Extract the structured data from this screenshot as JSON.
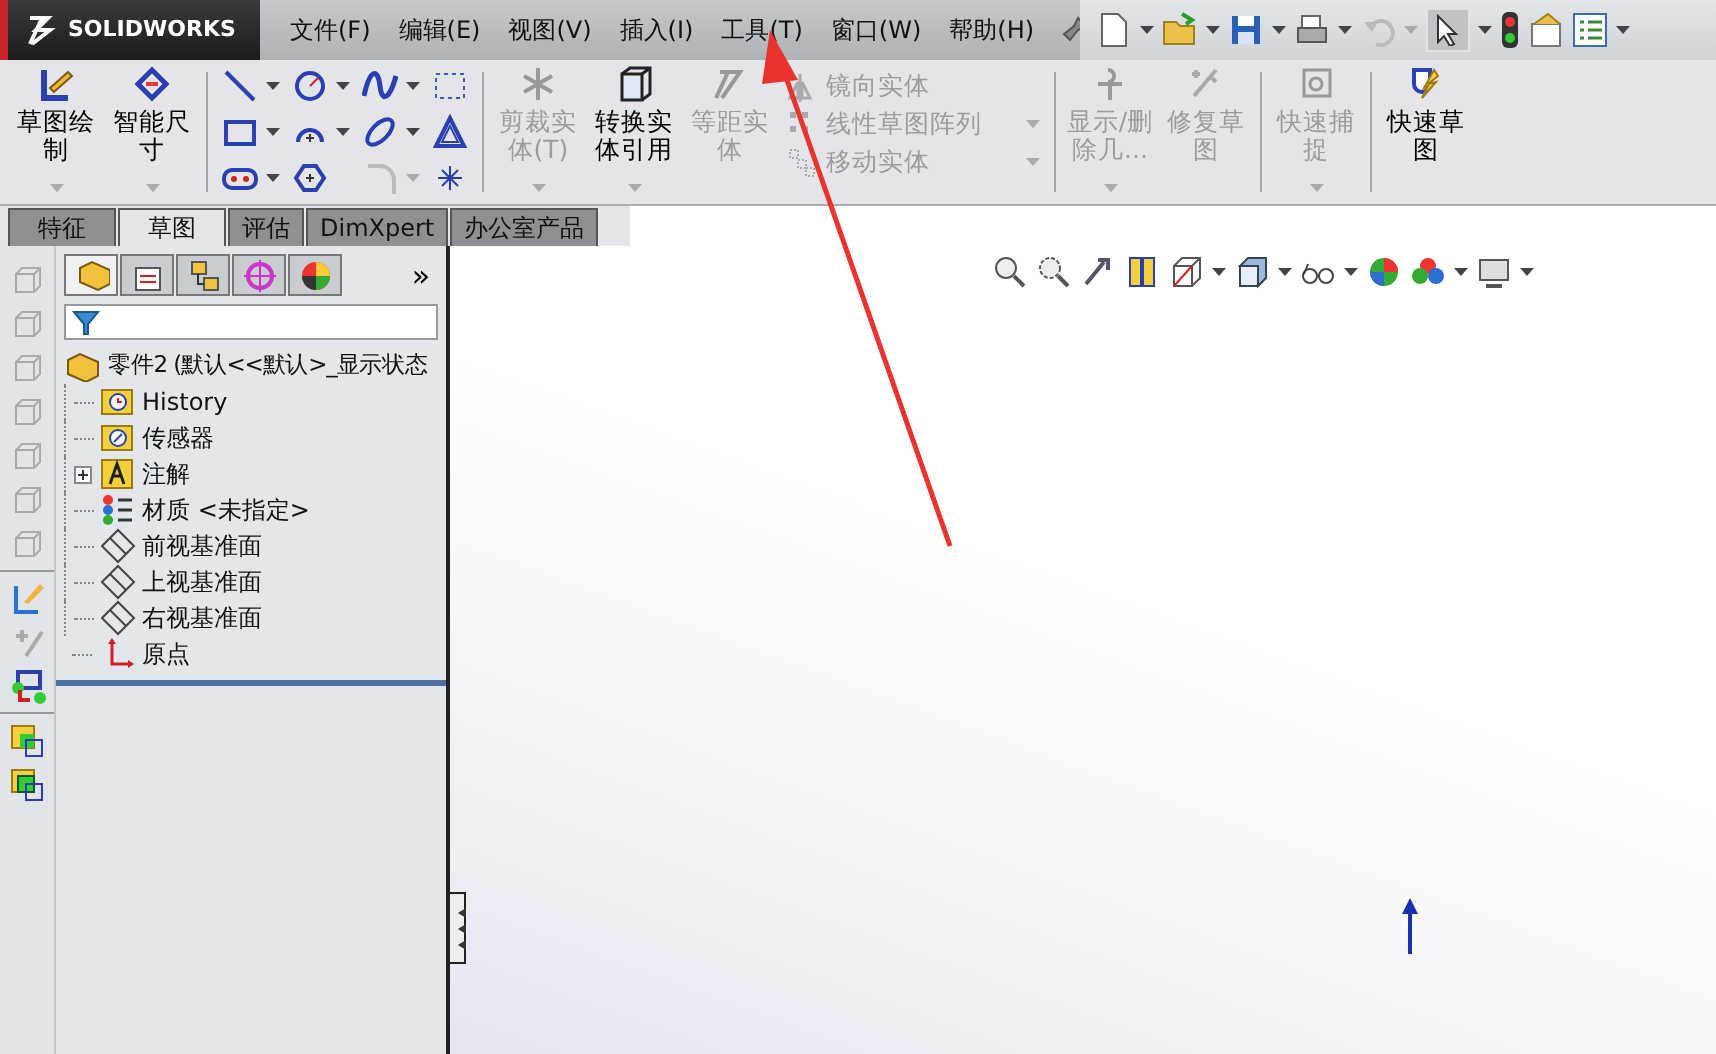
{
  "logo": {
    "text": "SOLIDWORKS"
  },
  "menu": [
    {
      "label": "文件(F)"
    },
    {
      "label": "编辑(E)"
    },
    {
      "label": "视图(V)"
    },
    {
      "label": "插入(I)"
    },
    {
      "label": "工具(T)"
    },
    {
      "label": "窗口(W)"
    },
    {
      "label": "帮助(H)"
    }
  ],
  "ribbon": {
    "items": [
      {
        "kind": "large",
        "label": "草图绘制",
        "disabled": false,
        "dropdown": true
      },
      {
        "kind": "large",
        "label": "智能尺寸",
        "disabled": false,
        "dropdown": true
      },
      {
        "kind": "separator"
      },
      {
        "kind": "tool_grid"
      },
      {
        "kind": "separator"
      },
      {
        "kind": "large",
        "label": "剪裁实体(T)",
        "disabled": true,
        "dropdown": true
      },
      {
        "kind": "large",
        "label": "转换实体引用",
        "disabled": false,
        "dropdown": true
      },
      {
        "kind": "large",
        "label": "等距实体",
        "disabled": true,
        "dropdown": false
      },
      {
        "kind": "stack",
        "entries": [
          {
            "label": "镜向实体",
            "disabled": true,
            "dropdown": false
          },
          {
            "label": "线性草图阵列",
            "disabled": true,
            "dropdown": true
          },
          {
            "label": "移动实体",
            "disabled": true,
            "dropdown": true
          }
        ]
      },
      {
        "kind": "separator"
      },
      {
        "kind": "large",
        "label": "显示/删除几...",
        "disabled": true,
        "dropdown": true
      },
      {
        "kind": "large",
        "label": "修复草图",
        "disabled": true,
        "dropdown": false
      },
      {
        "kind": "separator"
      },
      {
        "kind": "large",
        "label": "快速捕捉",
        "disabled": true,
        "dropdown": true
      },
      {
        "kind": "separator"
      },
      {
        "kind": "large",
        "label": "快速草图",
        "disabled": false,
        "dropdown": false
      }
    ]
  },
  "tabs": [
    {
      "label": "特征",
      "selected": false
    },
    {
      "label": "草图",
      "selected": true
    },
    {
      "label": "评估",
      "selected": false
    },
    {
      "label": "DimXpert",
      "selected": false
    },
    {
      "label": "办公室产品",
      "selected": false
    }
  ],
  "feature_manager": {
    "panel_tabs": [
      {
        "selected": true
      },
      {
        "selected": false
      },
      {
        "selected": false
      },
      {
        "selected": false
      },
      {
        "selected": false
      }
    ],
    "more": "»",
    "tree": {
      "label": "零件2  (默认<<默认>_显示状态",
      "children": [
        {
          "label": "History"
        },
        {
          "label": "传感器"
        },
        {
          "label": "注解",
          "expanded": false
        },
        {
          "label": "材质 <未指定>"
        },
        {
          "label": "前视基准面"
        },
        {
          "label": "上视基准面"
        },
        {
          "label": "右视基准面"
        },
        {
          "label": "原点"
        }
      ]
    }
  }
}
